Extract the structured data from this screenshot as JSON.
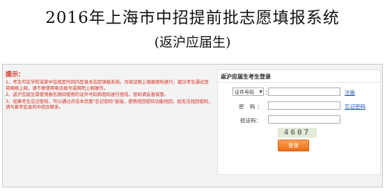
{
  "header": {
    "title": "2016年上海市中招提前批志愿填报系统",
    "subtitle": "(返沪应届生)"
  },
  "tips": {
    "heading": "提示：",
    "items": [
      "1、考生可在学校或家中在规定时间内登录本志愿填报系统。为保证网上填报顺利进行，建议考生通过宽带网络上网，请不要使用电话拨号或网吧上网操作。",
      "2、返沪应届生需使用报名期间使用的证件号码和密码进行登陆，密码请妥善保管。",
      "3、如果考生忘记密码，可以通过点击本页面\"忘记密码\"链接，使用找回密码功能找回，如无法找回密码，请与报考区县的中招办联系。"
    ]
  },
  "login": {
    "title": "返沪应届生考生登录",
    "id_type": {
      "selected": "证件号码",
      "arrow": "▼"
    },
    "colon": "：",
    "register_link": "注册",
    "password_label": "密 码：",
    "forgot_link": "忘记密码",
    "captcha_label": "验证码：",
    "captcha_code": "4607",
    "submit_label": "登录"
  },
  "colors": {
    "tip_red": "#d52b1e",
    "button_orange": "#ee6c13",
    "link_blue": "#1a55a8"
  }
}
